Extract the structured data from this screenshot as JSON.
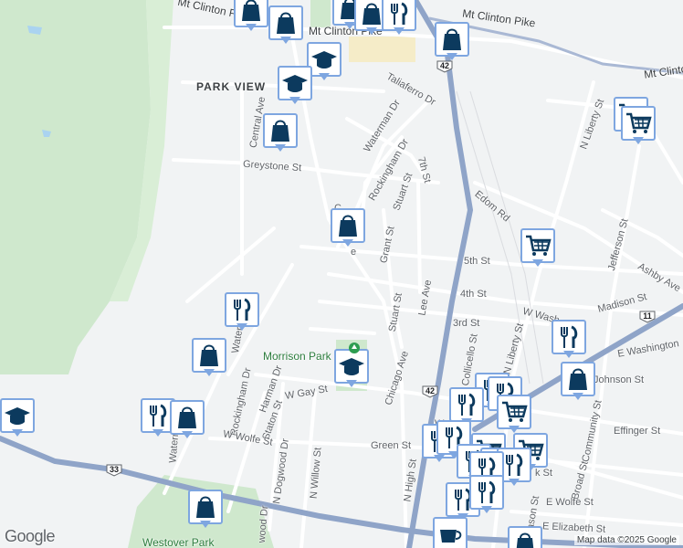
{
  "map": {
    "colors": {
      "background": "#f1f3f4",
      "green_area": "#cfe8cd",
      "highway": "#8fa4c8",
      "road": "#ffffff",
      "pin_icon": "#0c3a5e",
      "pin_border": "#7ea6e0"
    },
    "areas": {
      "neighborhood": "PARK VIEW",
      "park_1": "Morrison Park",
      "park_2": "Westover Park"
    },
    "streets": {
      "mt_clinton_pike_top": "Mt Clinton Pike",
      "mt_clinton_pike_mid": "Mt Clinton Pike",
      "mt_clinton_pike_right": "Mt Clinton",
      "taliaferro": "Taliaferro Dr",
      "waterman_dr": "Waterman Dr",
      "central_ave": "Central Ave",
      "greystone": "Greystone St",
      "rockingham_dr_top": "Rockingham Dr",
      "stuart_st_top": "Stuart St",
      "seventh_st": "7th St",
      "edom_rd": "Edom Rd",
      "n_liberty_st_top": "N Liberty St",
      "jefferson": "Jefferson St",
      "ashby": "Ashby Ave",
      "fifth_st": "5th St",
      "grant_st": "Grant St",
      "chicago_partial": "C",
      "chicago_partial_2": "e",
      "fourth_st": "4th St",
      "madison": "Madison St",
      "lee_ave": "Lee Ave",
      "stuart_st_mid": "Stuart St",
      "third_st": "3rd St",
      "w_wash": "W Wash",
      "e_washington": "E Washington",
      "n_liberty_st_mid": "N Liberty St",
      "collicello": "Collicello St",
      "johnson": "Johnson St",
      "chicago_ave": "Chicago Ave",
      "rockingham_dr_left": "Rockingham Dr",
      "harman_dr": "Harman Dr",
      "w_gay_st": "W Gay St",
      "staton_st": "Staton St",
      "w_wolfe_st": "W Wolfe St",
      "green_st": "Green St",
      "effinger": "Effinger St",
      "community": "Community St",
      "broad": "Broad St",
      "n_high_st": "N High St",
      "n_dogwood": "N Dogwood Dr",
      "n_willow": "N Willow St",
      "e_wolfe": "E Wolfe St",
      "e_elizabeth": "E Elizabeth St",
      "mason": "Mason St",
      "wood_dr": "wood Dr",
      "waterman_partial": "Waterm",
      "waterman_mid": "Waterm",
      "k_st": "k St",
      "w_st": "W"
    },
    "shields": {
      "us42_top": "42",
      "us42_mid": "42",
      "us11": "11",
      "us33": "33"
    },
    "attribution": "Map data ©2025 Google",
    "logo": "Google"
  }
}
